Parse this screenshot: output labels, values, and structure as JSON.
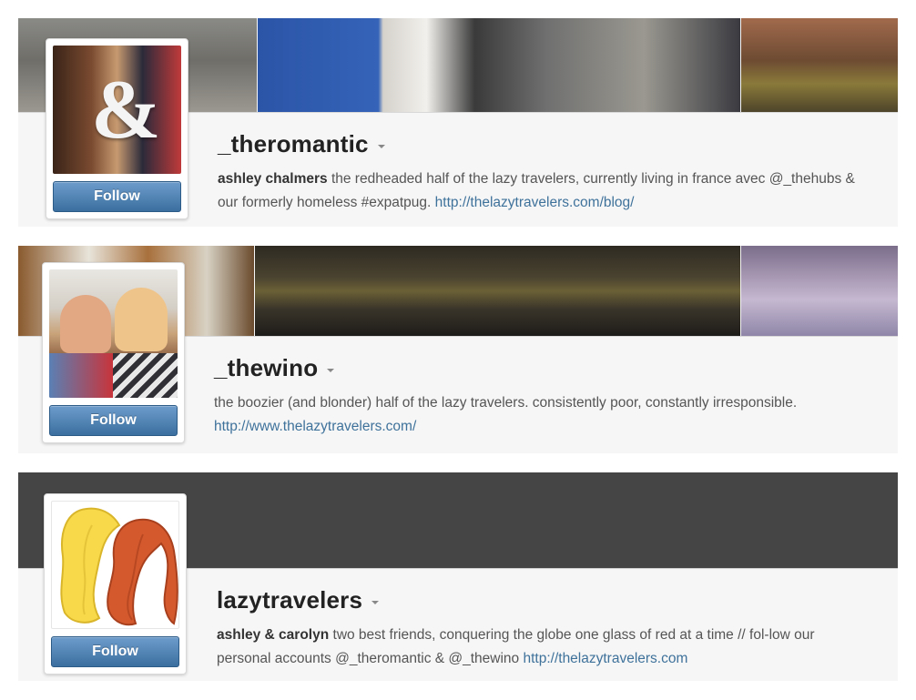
{
  "profiles": [
    {
      "username": "_theromantic",
      "bio_name": "ashley chalmers",
      "bio_text": " the redheaded half of the lazy travelers, currently living in france avec @_thehubs & our formerly homeless #expatpug. ",
      "bio_link": "http://thelazytravelers.com/blog/",
      "follow_label": "Follow",
      "avatar_glyph": "&"
    },
    {
      "username": "_thewino",
      "bio_name": "",
      "bio_text": "the boozier (and blonder) half of the lazy travelers. consistently poor, constantly irresponsible. ",
      "bio_link": "http://www.thelazytravelers.com/",
      "follow_label": "Follow"
    },
    {
      "username": "lazytravelers",
      "bio_name": "ashley & carolyn",
      "bio_text": " two best friends, conquering the globe one glass of red at a time // fol-low our personal accounts @_theromantic & @_thewino ",
      "bio_link": "http://thelazytravelers.com",
      "follow_label": "Follow"
    }
  ],
  "colors": {
    "follow_button": "#4a7fb0",
    "link": "#3f729b",
    "card_background": "#f6f6f6",
    "dark_banner": "#454545"
  },
  "icons": [
    "dropdown-caret-icon"
  ]
}
